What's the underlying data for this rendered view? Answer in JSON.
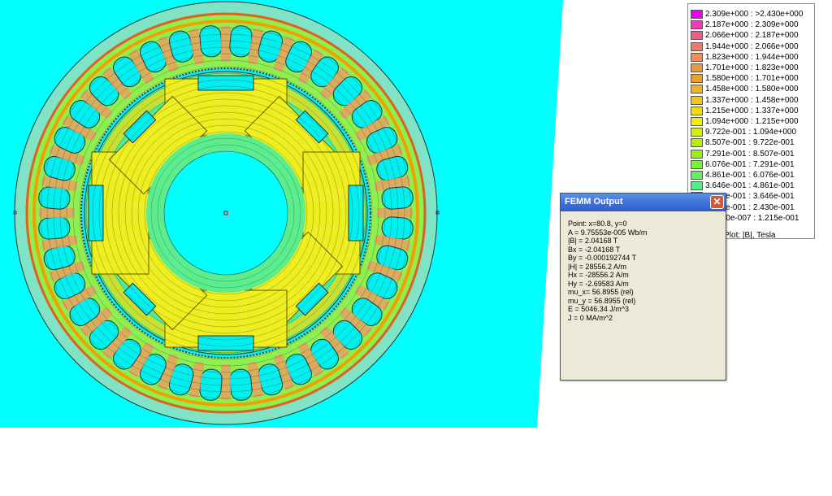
{
  "legend": {
    "rows": [
      {
        "label": "2.309e+000 : >2.430e+000",
        "color": "#f000f0"
      },
      {
        "label": "2.187e+000 : 2.309e+000",
        "color": "#f03cb4"
      },
      {
        "label": "2.066e+000 : 2.187e+000",
        "color": "#f05a8c"
      },
      {
        "label": "1.944e+000 : 2.066e+000",
        "color": "#f0786e"
      },
      {
        "label": "1.823e+000 : 1.944e+000",
        "color": "#f08c5a"
      },
      {
        "label": "1.701e+000 : 1.823e+000",
        "color": "#f0963c"
      },
      {
        "label": "1.580e+000 : 1.701e+000",
        "color": "#f0a028"
      },
      {
        "label": "1.458e+000 : 1.580e+000",
        "color": "#f0b41e"
      },
      {
        "label": "1.337e+000 : 1.458e+000",
        "color": "#f0c814"
      },
      {
        "label": "1.215e+000 : 1.337e+000",
        "color": "#f0dc0a"
      },
      {
        "label": "1.094e+000 : 1.215e+000",
        "color": "#f0f000"
      },
      {
        "label": "9.722e-001 : 1.094e+000",
        "color": "#d2f000"
      },
      {
        "label": "8.507e-001 : 9.722e-001",
        "color": "#b4f000"
      },
      {
        "label": "7.291e-001 : 8.507e-001",
        "color": "#96f014"
      },
      {
        "label": "6.076e-001 : 7.291e-001",
        "color": "#78f03c"
      },
      {
        "label": "4.861e-001 : 6.076e-001",
        "color": "#64f064"
      },
      {
        "label": "3.646e-001 : 4.861e-001",
        "color": "#50f08c"
      },
      {
        "label": "2.430e-001 : 3.646e-001",
        "color": "#3cf0b4"
      },
      {
        "label": "1.215e-001 : 2.430e-001",
        "color": "#1ef0dc"
      },
      {
        "label": "<1.210e-007 : 1.215e-001",
        "color": "#00f0f0"
      }
    ],
    "caption": "Density Plot: |B|, Tesla"
  },
  "femm_output": {
    "title": "FEMM Output",
    "close_label": "✕",
    "lines": [
      "Point: x=80.8, y=0",
      "A  = 9.75553e-005 Wb/m",
      "|B| = 2.04168 T",
      "Bx  = -2.04168 T",
      "By  = -0.000192744 T",
      "|H| = 28556.2 A/m",
      "Hx  = -28556.2 A/m",
      "Hy  = -2.69583 A/m",
      "mu_x= 56.8955 (rel)",
      "mu_y = 56.8955 (rel)",
      "E  = 5046.34 J/m^3",
      "J  = 0 MA/m^2"
    ]
  },
  "colors": {
    "background": "#00ffff",
    "air_gap": "#7fe3c6",
    "yoke": "#8ef050",
    "rotor_core": "#4cec9a",
    "pole_body": "#eeee20",
    "slot": "#00f0f0",
    "tooth_tip": "#e8a060"
  },
  "model": {
    "stator_slots": 36,
    "rotor_poles": 4
  }
}
